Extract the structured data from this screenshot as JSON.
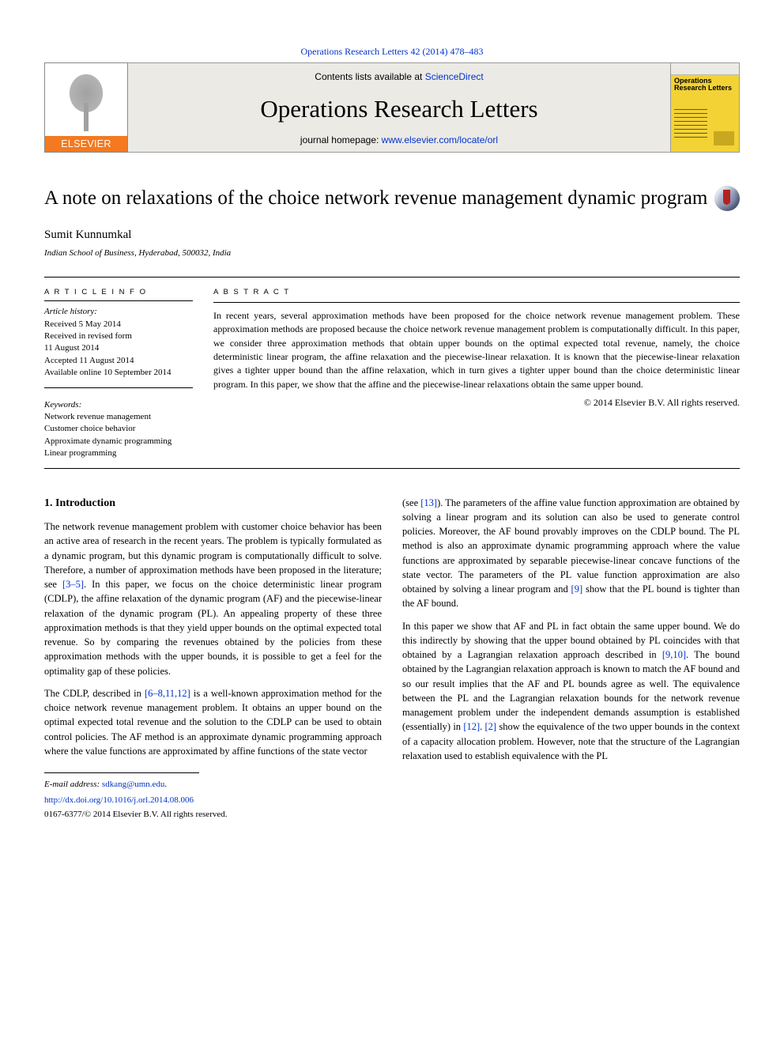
{
  "citation": {
    "journal": "Operations Research Letters",
    "vol_pages": "42 (2014) 478–483"
  },
  "banner": {
    "contents_prefix": "Contents lists available at ",
    "sciencedirect": "ScienceDirect",
    "journal_name": "Operations Research Letters",
    "homepage_prefix": "journal homepage: ",
    "homepage_link": "www.elsevier.com/locate/orl",
    "elsevier_brand": "ELSEVIER",
    "cover_title": "Operations Research Letters"
  },
  "title": "A note on relaxations of the choice network revenue management dynamic program",
  "author": "Sumit Kunnumkal",
  "affiliation": "Indian School of Business, Hyderabad, 500032, India",
  "article_info": {
    "heading": "A R T I C L E   I N F O",
    "history_label": "Article history:",
    "received": "Received 5 May 2014",
    "revised": "Received in revised form",
    "revised_date": "11 August 2014",
    "accepted": "Accepted 11 August 2014",
    "online": "Available online 10 September 2014",
    "keywords_label": "Keywords:",
    "kw1": "Network revenue management",
    "kw2": "Customer choice behavior",
    "kw3": "Approximate dynamic programming",
    "kw4": "Linear programming"
  },
  "abstract": {
    "heading": "A B S T R A C T",
    "text": "In recent years, several approximation methods have been proposed for the choice network revenue management problem. These approximation methods are proposed because the choice network revenue management problem is computationally difficult. In this paper, we consider three approximation methods that obtain upper bounds on the optimal expected total revenue, namely, the choice deterministic linear program, the affine relaxation and the piecewise-linear relaxation. It is known that the piecewise-linear relaxation gives a tighter upper bound than the affine relaxation, which in turn gives a tighter upper bound than the choice deterministic linear program. In this paper, we show that the affine and the piecewise-linear relaxations obtain the same upper bound.",
    "rights": "© 2014 Elsevier B.V. All rights reserved."
  },
  "body": {
    "section_heading": "1. Introduction",
    "col1_p1": "The network revenue management problem with customer choice behavior has been an active area of research in the recent years. The problem is typically formulated as a dynamic program, but this dynamic program is computationally difficult to solve. Therefore, a number of approximation methods have been proposed in the literature; see ",
    "refs1": "[3–5]",
    "col1_p1b": ". In this paper, we focus on the choice deterministic linear program (CDLP), the affine relaxation of the dynamic program (AF) and the piecewise-linear relaxation of the dynamic program (PL). An appealing property of these three approximation methods is that they yield upper bounds on the optimal expected total revenue. So by comparing the revenues obtained by the policies from these approximation methods with the upper bounds, it is possible to get a feel for the optimality gap of these policies.",
    "col1_p2a": "The CDLP, described in ",
    "refs2": "[6–8,11,12]",
    "col1_p2b": " is a well-known approximation method for the choice network revenue management problem. It obtains an upper bound on the optimal expected total revenue and the solution to the CDLP can be used to obtain control policies. The AF method is an approximate dynamic programming approach where the value functions are approximated by affine functions of the state vector",
    "col2_p1a": "(see ",
    "refs3": "[13]",
    "col2_p1b": "). The parameters of the affine value function approximation are obtained by solving a linear program and its solution can also be used to generate control policies. Moreover, the AF bound provably improves on the CDLP bound. The PL method is also an approximate dynamic programming approach where the value functions are approximated by separable piecewise-linear concave functions of the state vector. The parameters of the PL value function approximation are also obtained by solving a linear program and ",
    "refs4": "[9]",
    "col2_p1c": " show that the PL bound is tighter than the AF bound.",
    "col2_p2": "In this paper we show that AF and PL in fact obtain the same upper bound. We do this indirectly by showing that the upper bound obtained by PL coincides with that obtained by a Lagrangian relaxation approach described in ",
    "refs5": "[9,10]",
    "col2_p2b": ". The bound obtained by the Lagrangian relaxation approach is known to match the AF bound and so our result implies that the AF and PL bounds agree as well. The equivalence between the PL and the Lagrangian relaxation bounds for the network revenue management problem under the independent demands assumption is established (essentially) in ",
    "refs6": "[12]",
    "col2_p2c": ". ",
    "refs7": "[2]",
    "col2_p2d": " show the equivalence of the two upper bounds in the context of a capacity allocation problem. However, note that the structure of the Lagrangian relaxation used to establish equivalence with the PL"
  },
  "footnotes": {
    "email_label": "E-mail address: ",
    "email": "sdkang@umn.edu",
    "email_suffix": ".",
    "doi": "http://dx.doi.org/10.1016/j.orl.2014.08.006",
    "copyright": "0167-6377/© 2014 Elsevier B.V. All rights reserved."
  }
}
